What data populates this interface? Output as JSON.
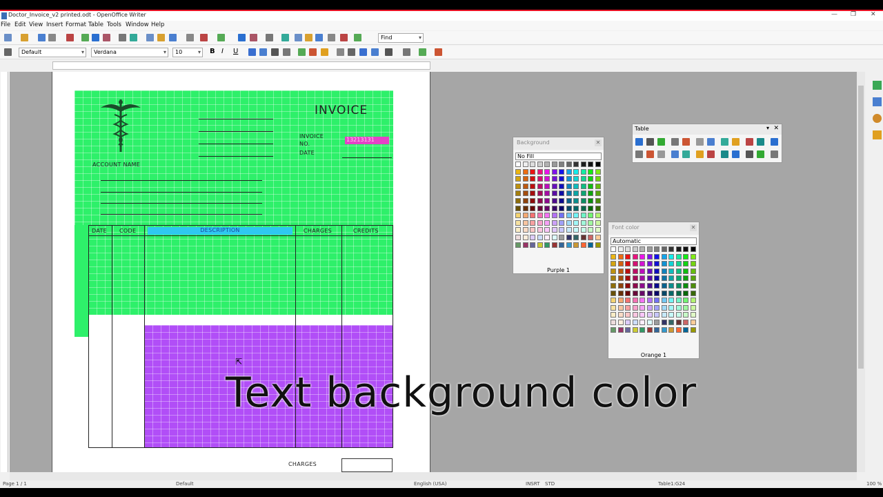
{
  "window": {
    "title": "Doctor_Invoice_v2 printed.odt - OpenOffice Writer"
  },
  "menu": [
    "File",
    "Edit",
    "View",
    "Insert",
    "Format",
    "Table",
    "Tools",
    "Window",
    "Help"
  ],
  "toolbar": {
    "find_placeholder": "Find",
    "style_value": "Default",
    "font_value": "Verdana",
    "size_value": "10"
  },
  "doc": {
    "invoice_title": "INVOICE",
    "invoice_no_label": "INVOICE\nNO.",
    "invoice_no_value": "13213131",
    "date_label": "DATE",
    "account_name_label": "ACCOUNT NAME",
    "columns": [
      "DATE",
      "CODE",
      "DESCRIPTION",
      "CHARGES",
      "CREDITS"
    ],
    "charges_footer": "CHARGES"
  },
  "background_panel": {
    "title": "Background",
    "nofill": "No Fill",
    "selected": "Purple 1"
  },
  "fontcolor_panel": {
    "title": "Font color",
    "auto": "Automatic",
    "selected": "Orange 1"
  },
  "table_panel": {
    "title": "Table"
  },
  "caption": "Text background color",
  "status": {
    "page": "Page 1 / 1",
    "style": "Default",
    "lang": "English (USA)",
    "insrt": "INSRT",
    "std": "STD",
    "cell": "Table1:G24",
    "zoom": "100 %"
  }
}
